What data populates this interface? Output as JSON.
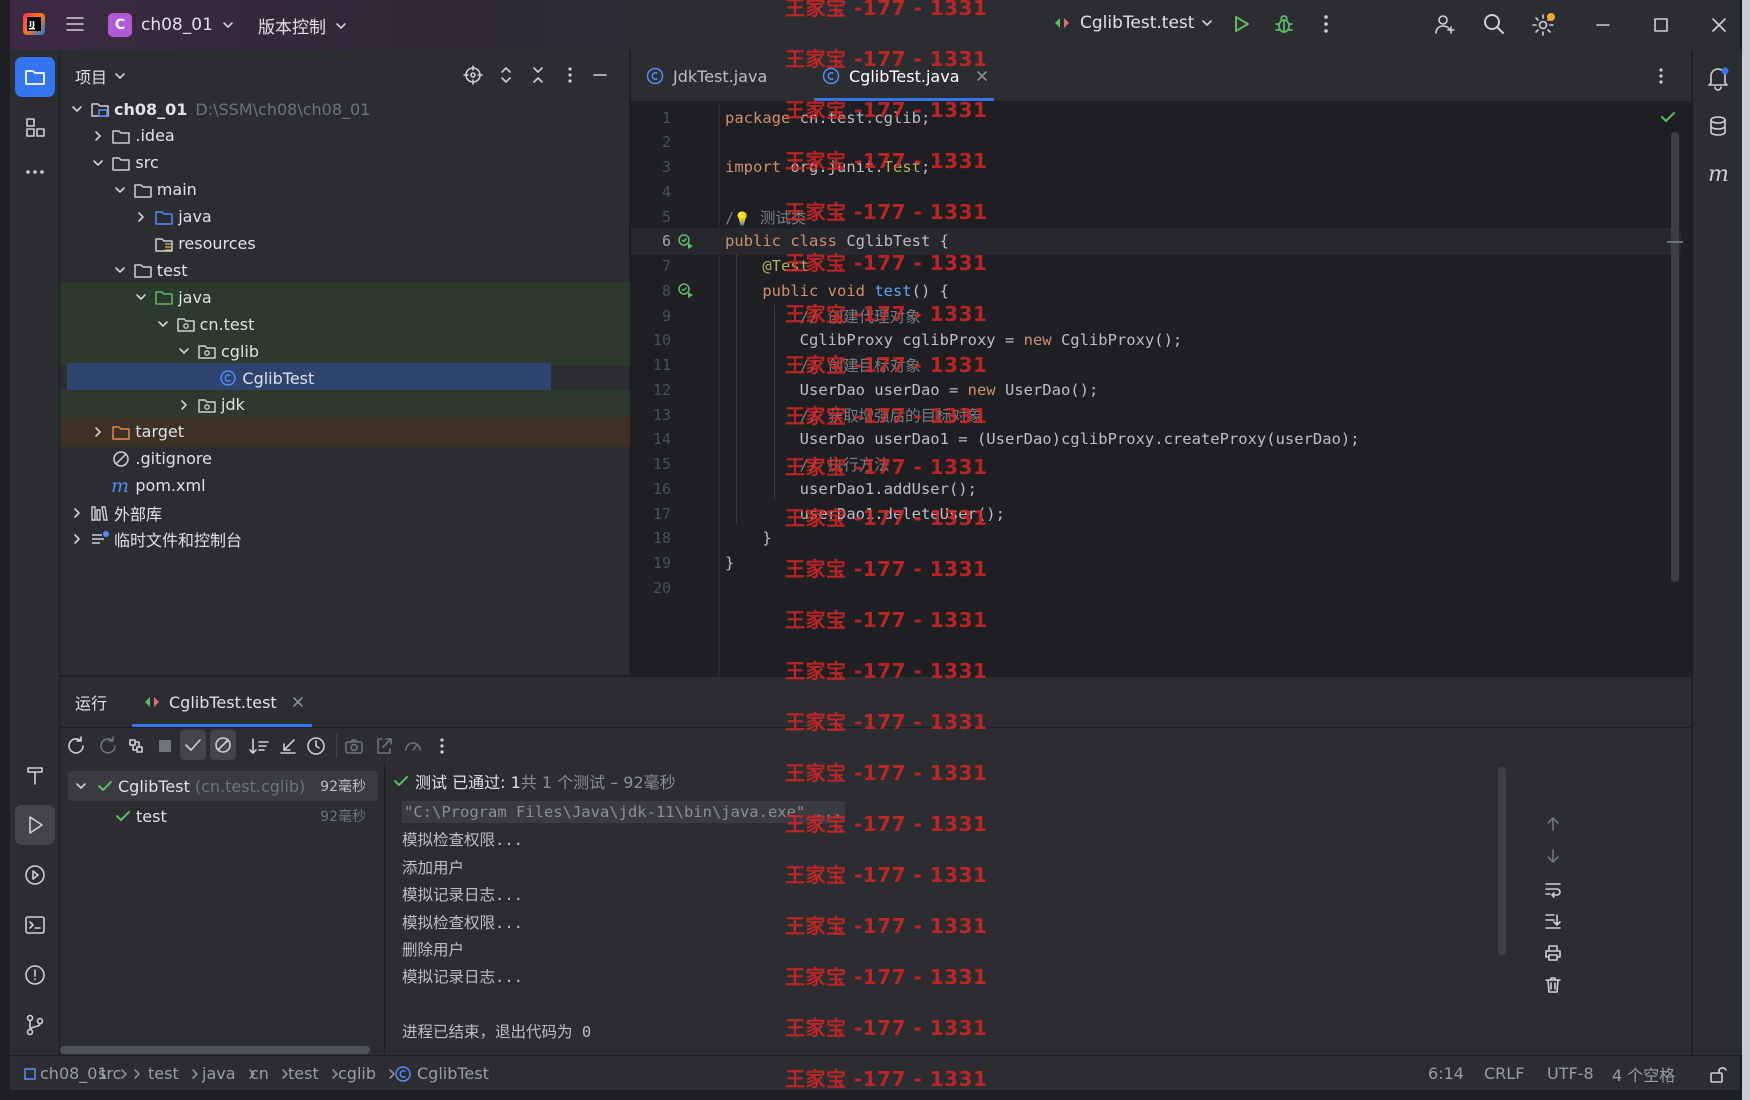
{
  "titlebar": {
    "project_badge": "C",
    "project_name": "ch08_01",
    "vcs_label": "版本控制",
    "run_config": "CglibTest.test"
  },
  "project_panel": {
    "title": "项目",
    "tree": [
      {
        "label": "ch08_01",
        "hint": "D:\\SSM\\ch08\\ch08_01",
        "depth": 0,
        "chevron": "down",
        "icon": "module-folder-icon",
        "bold": true
      },
      {
        "label": ".idea",
        "depth": 1,
        "chevron": "right",
        "icon": "folder-icon"
      },
      {
        "label": "src",
        "depth": 1,
        "chevron": "down",
        "icon": "folder-icon"
      },
      {
        "label": "main",
        "depth": 2,
        "chevron": "down",
        "icon": "folder-icon"
      },
      {
        "label": "java",
        "depth": 3,
        "chevron": "right",
        "icon": "source-folder-icon"
      },
      {
        "label": "resources",
        "depth": 3,
        "chevron": "none",
        "icon": "resources-folder-icon"
      },
      {
        "label": "test",
        "depth": 2,
        "chevron": "down",
        "icon": "folder-icon"
      },
      {
        "label": "java",
        "depth": 3,
        "chevron": "down",
        "icon": "test-folder-icon",
        "bg": "test"
      },
      {
        "label": "cn.test",
        "depth": 4,
        "chevron": "down",
        "icon": "package-icon",
        "bg": "test"
      },
      {
        "label": "cglib",
        "depth": 5,
        "chevron": "down",
        "icon": "package-icon",
        "bg": "test"
      },
      {
        "label": "CglibTest",
        "depth": 6,
        "chevron": "none",
        "icon": "class-icon",
        "bg": "selected"
      },
      {
        "label": "jdk",
        "depth": 5,
        "chevron": "right",
        "icon": "package-icon",
        "bg": "test"
      },
      {
        "label": "target",
        "depth": 1,
        "chevron": "right",
        "icon": "folder-excluded-icon",
        "bg": "excluded"
      },
      {
        "label": ".gitignore",
        "depth": 1,
        "chevron": "none",
        "icon": "ignore-file-icon"
      },
      {
        "label": "pom.xml",
        "depth": 1,
        "chevron": "none",
        "icon": "maven-icon"
      },
      {
        "label": "外部库",
        "depth": 0,
        "chevron": "right",
        "icon": "library-icon"
      },
      {
        "label": "临时文件和控制台",
        "depth": 0,
        "chevron": "right",
        "icon": "scratches-icon"
      }
    ]
  },
  "editor": {
    "tabs": [
      {
        "label": "JdkTest.java",
        "active": false
      },
      {
        "label": "CglibTest.java",
        "active": true
      }
    ],
    "current_line": 6,
    "lines": [
      {
        "n": "1",
        "tokens": [
          {
            "t": "package ",
            "c": "kw"
          },
          {
            "t": "cn.test.cglib;",
            "c": ""
          }
        ]
      },
      {
        "n": "2",
        "tokens": []
      },
      {
        "n": "3",
        "tokens": [
          {
            "t": "import ",
            "c": "kw"
          },
          {
            "t": "org.junit.",
            "c": ""
          },
          {
            "t": "Test",
            "c": "ann"
          },
          {
            "t": ";",
            "c": ""
          }
        ]
      },
      {
        "n": "4",
        "tokens": []
      },
      {
        "n": "5",
        "tokens": [
          {
            "t": "/",
            "c": "cmt"
          },
          {
            "t": "💡",
            "c": "bulb"
          },
          {
            "t": " 测试类",
            "c": "cmt"
          }
        ]
      },
      {
        "n": "6",
        "run": true,
        "tokens": [
          {
            "t": "public class ",
            "c": "kw"
          },
          {
            "t": "CglibTest {",
            "c": ""
          }
        ]
      },
      {
        "n": "7",
        "tokens": [
          {
            "t": "    ",
            "c": ""
          },
          {
            "t": "@Test",
            "c": "ann"
          }
        ]
      },
      {
        "n": "8",
        "run": true,
        "tokens": [
          {
            "t": "    ",
            "c": ""
          },
          {
            "t": "public void ",
            "c": "kw"
          },
          {
            "t": "test",
            "c": "fn"
          },
          {
            "t": "() {",
            "c": ""
          }
        ]
      },
      {
        "n": "9",
        "tokens": [
          {
            "t": "        ",
            "c": ""
          },
          {
            "t": "// 创建代理对象",
            "c": "cmt"
          }
        ]
      },
      {
        "n": "10",
        "tokens": [
          {
            "t": "        CglibProxy cglibProxy = ",
            "c": ""
          },
          {
            "t": "new ",
            "c": "kw"
          },
          {
            "t": "CglibProxy();",
            "c": ""
          }
        ]
      },
      {
        "n": "11",
        "tokens": [
          {
            "t": "        ",
            "c": ""
          },
          {
            "t": "// 创建目标对象",
            "c": "cmt"
          }
        ]
      },
      {
        "n": "12",
        "tokens": [
          {
            "t": "        UserDao userDao = ",
            "c": ""
          },
          {
            "t": "new ",
            "c": "kw"
          },
          {
            "t": "UserDao();",
            "c": ""
          }
        ]
      },
      {
        "n": "13",
        "tokens": [
          {
            "t": "        ",
            "c": ""
          },
          {
            "t": "// 获取增强后的目标对象",
            "c": "cmt"
          }
        ]
      },
      {
        "n": "14",
        "tokens": [
          {
            "t": "        UserDao userDao1 = (UserDao)cglibProxy.createProxy(userDao);",
            "c": ""
          }
        ]
      },
      {
        "n": "15",
        "tokens": [
          {
            "t": "        ",
            "c": ""
          },
          {
            "t": "// 执行方法",
            "c": "cmt"
          }
        ]
      },
      {
        "n": "16",
        "tokens": [
          {
            "t": "        userDao1.addUser();",
            "c": ""
          }
        ]
      },
      {
        "n": "17",
        "tokens": [
          {
            "t": "        userDao1.deleteUser();",
            "c": ""
          }
        ]
      },
      {
        "n": "18",
        "tokens": [
          {
            "t": "    }",
            "c": ""
          }
        ]
      },
      {
        "n": "19",
        "tokens": [
          {
            "t": "}",
            "c": ""
          }
        ]
      },
      {
        "n": "20",
        "tokens": []
      }
    ]
  },
  "run_panel": {
    "title": "运行",
    "tab_label": "CglibTest.test",
    "tree": [
      {
        "label": "CglibTest",
        "hint": "(cn.test.cglib)",
        "time": "92毫秒"
      },
      {
        "label": "test",
        "hint": "",
        "time": "92毫秒"
      }
    ],
    "status": {
      "prefix": "测试 已通过: 1",
      "detail": "共 1 个测试 – 92毫秒"
    },
    "console": [
      "\"C:\\Program Files\\Java\\jdk-11\\bin\\java.exe\" ...",
      "模拟检查权限...",
      "添加用户",
      "模拟记录日志...",
      "模拟检查权限...",
      "删除用户",
      "模拟记录日志...",
      "",
      "进程已结束，退出代码为 0"
    ]
  },
  "statusbar": {
    "breadcrumb": [
      "ch08_01",
      "src",
      "test",
      "java",
      "cn",
      "test",
      "cglib",
      "CglibTest"
    ],
    "position": "6:14",
    "line_ending": "CRLF",
    "encoding": "UTF-8",
    "indent": "4 个空格"
  },
  "watermark": "王家宝 -177 - 1331",
  "colors": {
    "accent": "#3574f0",
    "pass_green": "#5fb865",
    "watermark_red": "#d62626",
    "keyword": "#cf8e6d",
    "annotation": "#b3ae60"
  }
}
